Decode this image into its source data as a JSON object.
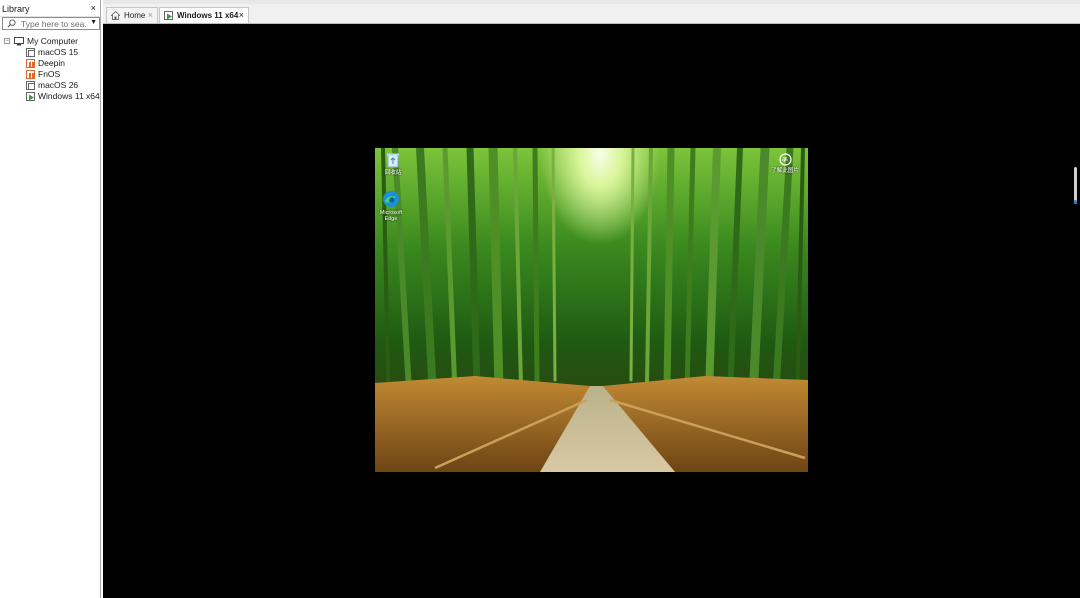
{
  "library": {
    "title": "Library",
    "close": "×",
    "search": {
      "placeholder": "Type here to sea..."
    },
    "root": {
      "label": "My Computer",
      "expander": "⊟"
    },
    "items": [
      {
        "label": "macOS 15"
      },
      {
        "label": "Deepin"
      },
      {
        "label": "FnOS"
      },
      {
        "label": "macOS 26"
      },
      {
        "label": "Windows 11 x64"
      }
    ]
  },
  "tabs": [
    {
      "label": "Home",
      "close": "×"
    },
    {
      "label": "Windows 11 x64",
      "close": "×"
    }
  ],
  "desktop": {
    "icons": [
      {
        "name": "recycle-bin",
        "label": "回收站"
      },
      {
        "name": "microsoft-edge",
        "label": "Microsoft Edge"
      },
      {
        "name": "learn-about-picture",
        "label": "了解此图片"
      }
    ]
  },
  "colors": {
    "console_bg": "#000000",
    "active_vm_green": "#3a9a3a",
    "vm_icon_orange": "#e0662a",
    "scroll_accent": "#2a7fd4"
  }
}
